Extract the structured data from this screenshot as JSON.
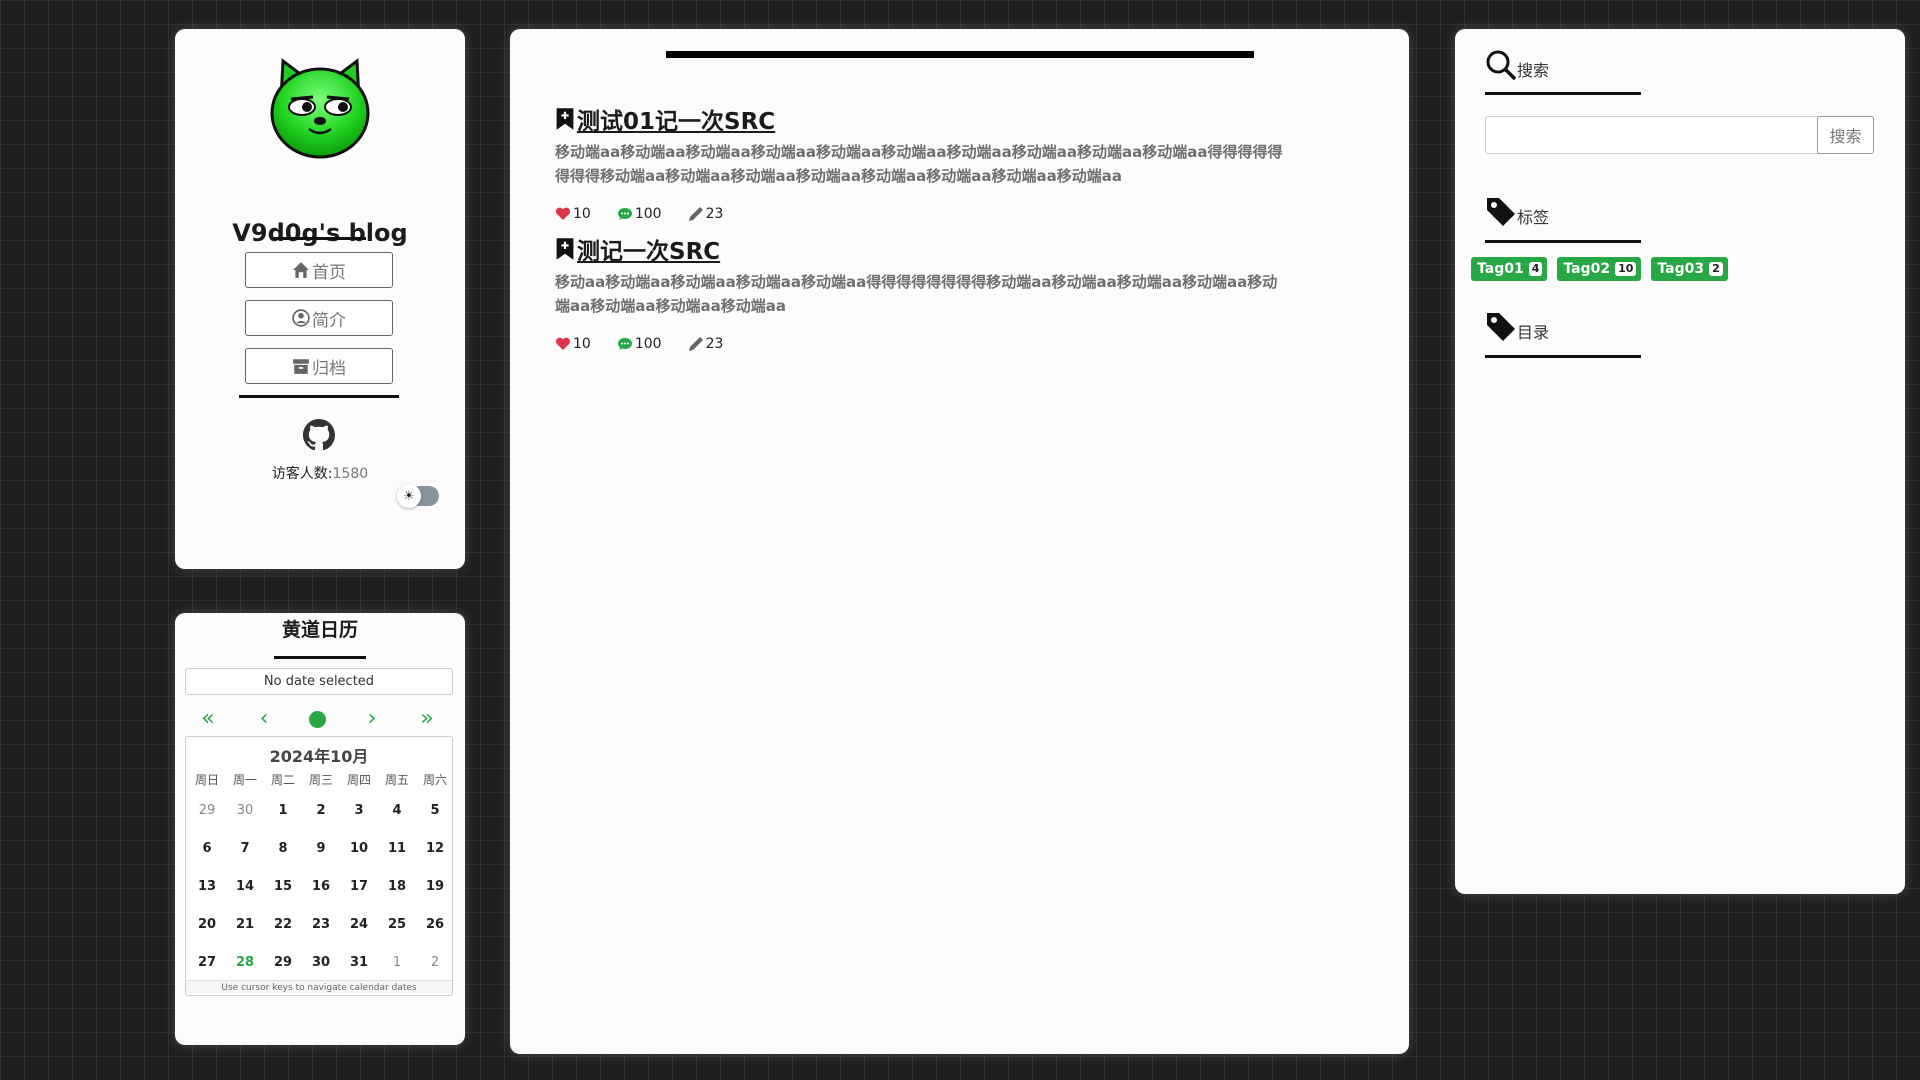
{
  "profile": {
    "blog_title": "V9d0g's blog",
    "nav": [
      {
        "label": "首页",
        "icon": "home-icon"
      },
      {
        "label": "简介",
        "icon": "user-circle-icon"
      },
      {
        "label": "归档",
        "icon": "archive-icon"
      }
    ],
    "visitors_label": "访客人数:",
    "visitors_count": "1580"
  },
  "calendar": {
    "title": "黄道日历",
    "selected_text": "No date selected",
    "month_label": "2024年10月",
    "weekdays": [
      "周日",
      "周一",
      "周二",
      "周三",
      "周四",
      "周五",
      "周六"
    ],
    "days": [
      "29",
      "30",
      "1",
      "2",
      "3",
      "4",
      "5",
      "6",
      "7",
      "8",
      "9",
      "10",
      "11",
      "12",
      "13",
      "14",
      "15",
      "16",
      "17",
      "18",
      "19",
      "20",
      "21",
      "22",
      "23",
      "24",
      "25",
      "26",
      "27",
      "28",
      "29",
      "30",
      "31",
      "1",
      "2"
    ],
    "today": "28",
    "hint": "Use cursor keys to navigate calendar dates",
    "accent": "#28a745"
  },
  "posts": [
    {
      "title": "测试01记一次SRC",
      "excerpt": "移动端aa移动端aa移动端aa移动端aa移动端aa移动端aa移动端aa移动端aa移动端aa移动端aa得得得得得得得得移动端aa移动端aa移动端aa移动端aa移动端aa移动端aa移动端aa移动端aa",
      "likes": "10",
      "comments": "100",
      "edits": "23"
    },
    {
      "title": "测记一次SRC",
      "excerpt": "移动aa移动端aa移动端aa移动端aa移动端aa得得得得得得得得移动端aa移动端aa移动端aa移动端aa移动端aa移动端aa移动端aa移动端aa",
      "likes": "10",
      "comments": "100",
      "edits": "23"
    }
  ],
  "sidebar": {
    "search_heading": "搜索",
    "search_button": "搜索",
    "search_value": "",
    "tags_heading": "标签",
    "tags": [
      {
        "name": "Tag01",
        "count": "4"
      },
      {
        "name": "Tag02",
        "count": "10"
      },
      {
        "name": "Tag03",
        "count": "2"
      }
    ],
    "toc_heading": "目录"
  }
}
